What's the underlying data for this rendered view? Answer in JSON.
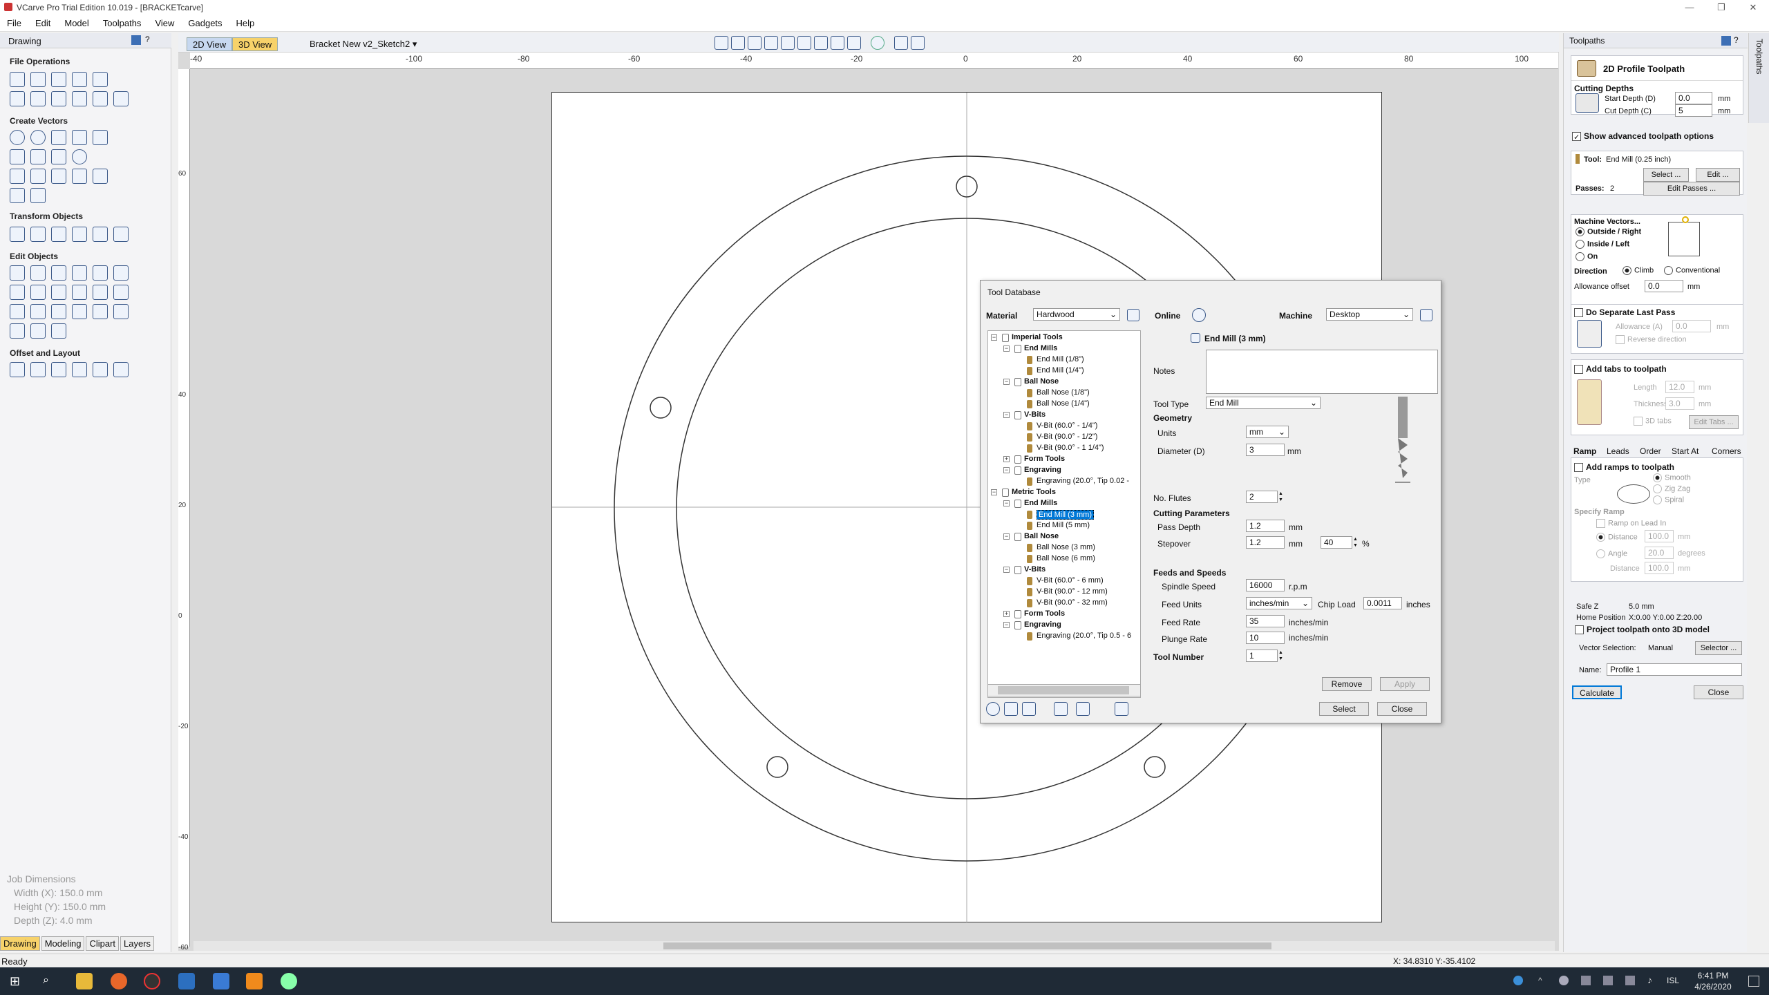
{
  "window": {
    "title": "VCarve Pro Trial Edition 10.019 - [BRACKETcarve]"
  },
  "menu": [
    "File",
    "Edit",
    "Model",
    "Toolpaths",
    "View",
    "Gadgets",
    "Help"
  ],
  "left": {
    "header": "Drawing",
    "sections": [
      "File Operations",
      "Create Vectors",
      "Transform Objects",
      "Edit Objects",
      "Offset and Layout"
    ],
    "job": {
      "title": "Job Dimensions",
      "width": "Width  (X): 150.0 mm",
      "height": "Height (Y): 150.0 mm",
      "depth": "Depth  (Z): 4.0 mm"
    },
    "tabs": [
      "Drawing",
      "Modeling",
      "Clipart",
      "Layers"
    ]
  },
  "view": {
    "tab2d": "2D View",
    "tab3d": "3D View",
    "sketch": "Bracket New v2_Sketch2",
    "hticks": [
      "-40",
      "-100",
      "-80",
      "-60",
      "-40",
      "-20",
      "0",
      "20",
      "40",
      "60",
      "80",
      "100"
    ],
    "vticks": [
      "60",
      "40",
      "20",
      "0",
      "-20",
      "-40",
      "-60"
    ]
  },
  "toolpath": {
    "panel_title": "Toolpaths",
    "title": "2D Profile Toolpath",
    "cutting_depths": "Cutting Depths",
    "start_depth_label": "Start Depth (D)",
    "start_depth": "0.0",
    "cut_depth_label": "Cut Depth (C)",
    "cut_depth": "5",
    "unit": "mm",
    "show_advanced": "Show advanced toolpath options",
    "tool_label": "Tool:",
    "tool": "End Mill (0.25 inch)",
    "select_btn": "Select ...",
    "edit_btn": "Edit ...",
    "passes_label": "Passes:",
    "passes": "2",
    "edit_passes": "Edit Passes ...",
    "machine_vectors": "Machine Vectors...",
    "outside": "Outside / Right",
    "inside": "Inside / Left",
    "on": "On",
    "direction": "Direction",
    "climb": "Climb",
    "conventional": "Conventional",
    "allowance_label": "Allowance offset",
    "allowance": "0.0",
    "separate_last": "Do Separate Last Pass",
    "allowance_a": "Allowance (A)",
    "allowance_a_val": "0.0",
    "reverse": "Reverse direction",
    "add_tabs": "Add tabs to toolpath",
    "length": "Length",
    "length_val": "12.0",
    "thickness": "Thickness",
    "thickness_val": "3.0",
    "tabs3d": "3D tabs",
    "edit_tabs": "Edit Tabs ...",
    "subtabs": [
      "Ramp",
      "Leads",
      "Order",
      "Start At",
      "Corners"
    ],
    "add_ramps": "Add ramps to toolpath",
    "type": "Type",
    "smooth": "Smooth",
    "zigzag": "Zig Zag",
    "spiral": "Spiral",
    "specify_ramp": "Specify Ramp",
    "ramp_lead": "Ramp on Lead In",
    "distance": "Distance",
    "distance_val": "100.0",
    "angle": "Angle",
    "angle_val": "20.0",
    "degrees": "degrees",
    "distance2": "Distance",
    "distance2_val": "100.0",
    "safe_z": "Safe Z",
    "safe_z_val": "5.0 mm",
    "home": "Home Position",
    "home_val": "X:0.00 Y:0.00 Z:20.00",
    "project": "Project toolpath onto 3D model",
    "vector_sel": "Vector Selection:",
    "manual": "Manual",
    "selector": "Selector ...",
    "name_label": "Name:",
    "name": "Profile 1",
    "calculate": "Calculate",
    "close": "Close"
  },
  "tooldb": {
    "title": "Tool Database",
    "material_label": "Material",
    "material": "Hardwood",
    "online": "Online",
    "machine_label": "Machine",
    "machine": "Desktop",
    "selected": "End Mill (3 mm)",
    "notes": "Notes",
    "tool_type_label": "Tool Type",
    "tool_type": "End Mill",
    "geometry": "Geometry",
    "units_label": "Units",
    "units": "mm",
    "diameter_label": "Diameter (D)",
    "diameter": "3",
    "mm": "mm",
    "flutes_label": "No. Flutes",
    "flutes": "2",
    "cutting_params": "Cutting Parameters",
    "pass_depth_label": "Pass Depth",
    "pass_depth": "1.2",
    "stepover_label": "Stepover",
    "stepover": "1.2",
    "stepover_pct": "40",
    "pct": "%",
    "feeds": "Feeds and Speeds",
    "spindle_label": "Spindle Speed",
    "spindle": "16000",
    "rpm": "r.p.m",
    "feed_units_label": "Feed Units",
    "feed_units": "inches/min",
    "chip_label": "Chip Load",
    "chip": "0.0011",
    "inches": "inches",
    "feed_rate_label": "Feed Rate",
    "feed_rate": "35",
    "plunge_label": "Plunge Rate",
    "plunge": "10",
    "ipm": "inches/min",
    "tool_number_label": "Tool Number",
    "tool_number": "1",
    "remove": "Remove",
    "apply": "Apply",
    "select": "Select",
    "close": "Close",
    "tree": [
      {
        "t": "Imperial Tools",
        "l": 0,
        "b": true
      },
      {
        "t": "End Mills",
        "l": 1,
        "b": true
      },
      {
        "t": "End Mill (1/8\")",
        "l": 2
      },
      {
        "t": "End Mill (1/4\")",
        "l": 2
      },
      {
        "t": "Ball Nose",
        "l": 1,
        "b": true
      },
      {
        "t": "Ball Nose (1/8\")",
        "l": 2
      },
      {
        "t": "Ball Nose (1/4\")",
        "l": 2
      },
      {
        "t": "V-Bits",
        "l": 1,
        "b": true
      },
      {
        "t": "V-Bit (60.0° - 1/4\")",
        "l": 2
      },
      {
        "t": "V-Bit (90.0° - 1/2\")",
        "l": 2
      },
      {
        "t": "V-Bit (90.0° - 1 1/4\")",
        "l": 2
      },
      {
        "t": "Form Tools",
        "l": 1,
        "b": true
      },
      {
        "t": "Engraving",
        "l": 1,
        "b": true
      },
      {
        "t": "Engraving (20.0°, Tip 0.02 -",
        "l": 2
      },
      {
        "t": "Metric Tools",
        "l": 0,
        "b": true
      },
      {
        "t": "End Mills",
        "l": 1,
        "b": true
      },
      {
        "t": "End Mill (3 mm)",
        "l": 2,
        "sel": true
      },
      {
        "t": "End Mill (5 mm)",
        "l": 2
      },
      {
        "t": "Ball Nose",
        "l": 1,
        "b": true
      },
      {
        "t": "Ball Nose (3 mm)",
        "l": 2
      },
      {
        "t": "Ball Nose (6 mm)",
        "l": 2
      },
      {
        "t": "V-Bits",
        "l": 1,
        "b": true
      },
      {
        "t": "V-Bit (60.0° - 6 mm)",
        "l": 2
      },
      {
        "t": "V-Bit (90.0° - 12 mm)",
        "l": 2
      },
      {
        "t": "V-Bit (90.0° - 32 mm)",
        "l": 2
      },
      {
        "t": "Form Tools",
        "l": 1,
        "b": true
      },
      {
        "t": "Engraving",
        "l": 1,
        "b": true
      },
      {
        "t": "Engraving (20.0°, Tip 0.5 - 6",
        "l": 2
      }
    ]
  },
  "status": {
    "ready": "Ready",
    "coords": "X: 34.8310 Y:-35.4102"
  },
  "taskbar": {
    "time": "6:41 PM",
    "date": "4/26/2020",
    "lang": "ISL"
  }
}
